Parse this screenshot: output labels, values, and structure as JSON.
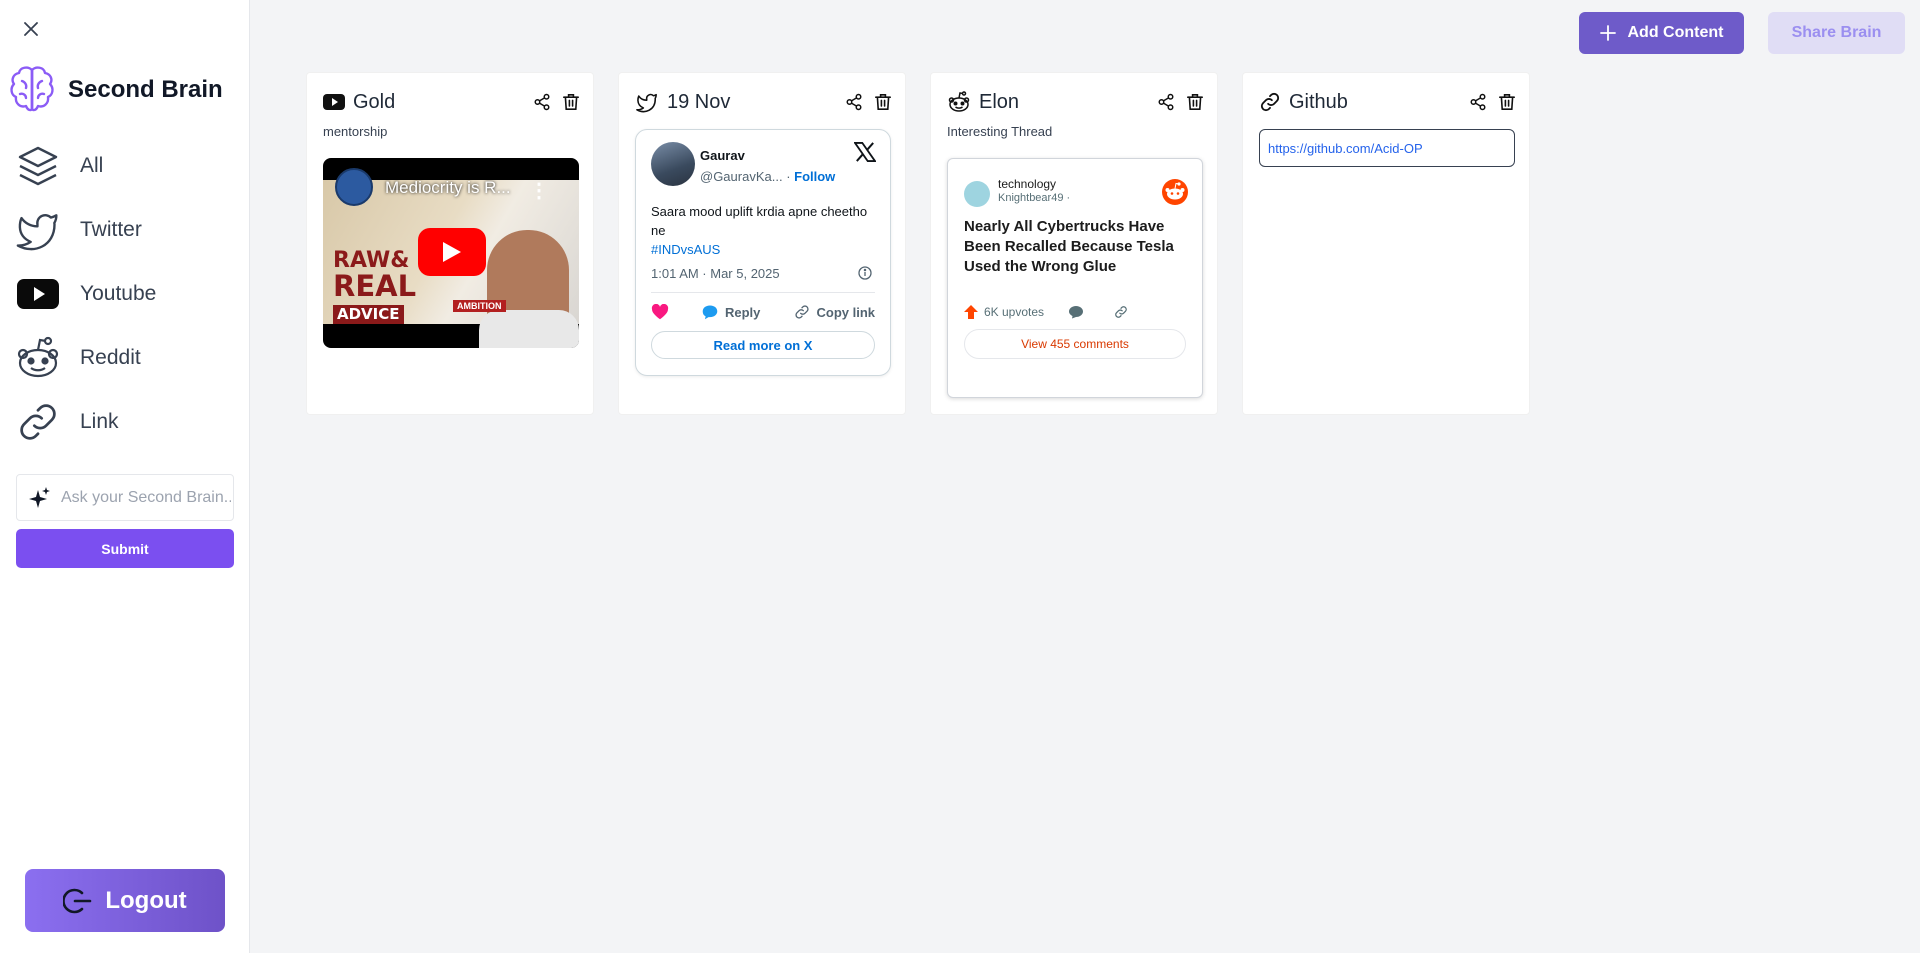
{
  "sidebar": {
    "brand_title": "Second Brain",
    "nav": [
      {
        "label": "All",
        "icon": "layers-icon"
      },
      {
        "label": "Twitter",
        "icon": "twitter-icon"
      },
      {
        "label": "Youtube",
        "icon": "youtube-icon"
      },
      {
        "label": "Reddit",
        "icon": "reddit-icon"
      },
      {
        "label": "Link",
        "icon": "link-icon"
      }
    ],
    "ask_placeholder": "Ask your Second Brain...",
    "submit_label": "Submit",
    "logout_label": "Logout"
  },
  "header": {
    "add_content_label": "Add Content",
    "share_brain_label": "Share Brain"
  },
  "cards": {
    "youtube": {
      "title": "Gold",
      "subtitle": "mentorship",
      "video_title": "Mediocrity is R...",
      "thumb_line1": "RAW&",
      "thumb_line2": "REAL",
      "thumb_line3": "ADVICE",
      "thumb_badge": "AMBITION"
    },
    "twitter": {
      "title": "19 Nov",
      "author_name": "Gaurav",
      "author_handle": "@GauravKa...",
      "follow_label": "Follow",
      "text": "Saara mood uplift krdia apne cheetho ne",
      "hashtag": "#INDvsAUS",
      "timestamp": "1:01 AM · Mar 5, 2025",
      "reply_label": "Reply",
      "copy_label": "Copy link",
      "read_more_label": "Read more on X"
    },
    "reddit": {
      "title": "Elon",
      "subtitle": "Interesting Thread",
      "subreddit": "technology",
      "user": "Knightbear49 ·",
      "post_title": "Nearly All Cybertrucks Have Been Recalled Because Tesla Used the Wrong Glue",
      "upvotes": "6K upvotes",
      "view_comments": "View 455 comments"
    },
    "link": {
      "title": "Github",
      "url": "https://github.com/Acid-OP"
    }
  },
  "colors": {
    "primary": "#7b4ff0",
    "add_content_bg": "#6e5bc9",
    "share_brain_bg": "#e0ddf5",
    "share_brain_text": "#9b8ff0",
    "background": "#f3f4f6"
  }
}
